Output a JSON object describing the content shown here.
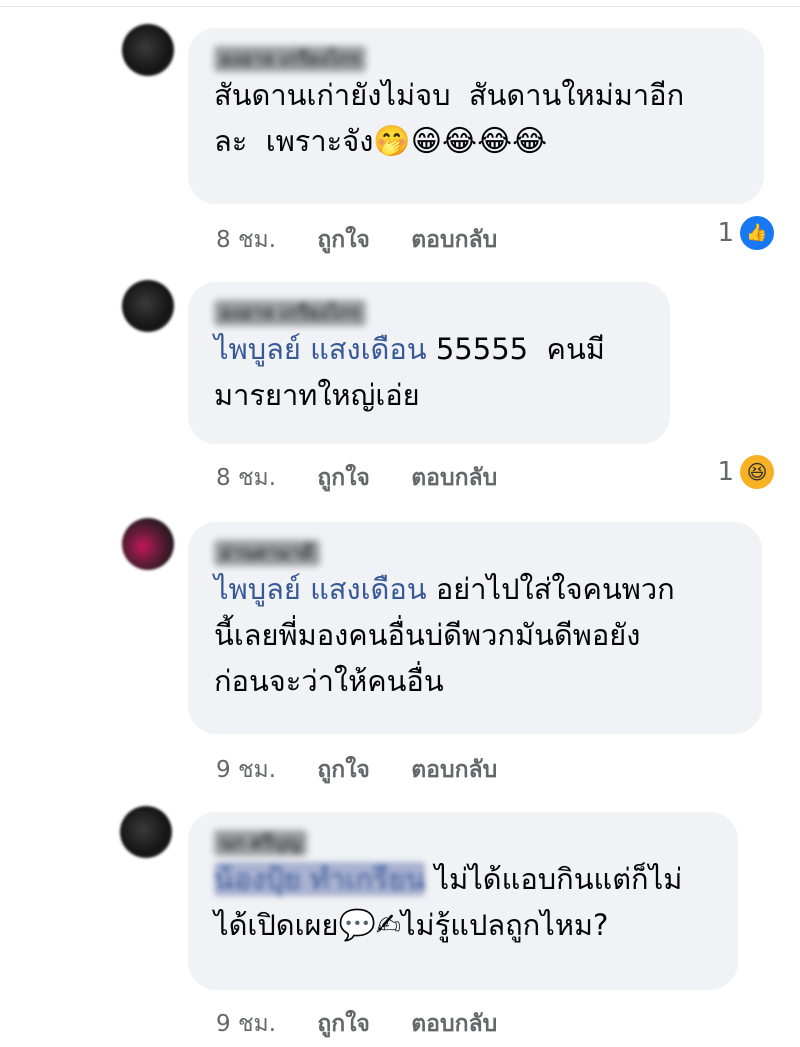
{
  "comments": [
    {
      "author": "องอาจ เกรียงไกร",
      "text": "สันดานเก่ายังไม่จบ  สันดานใหม่มาอีก\nละ  เพราะจัง",
      "emojis": "🤭😁😂😂😂",
      "time": "8 ชม.",
      "like_label": "ถูกใจ",
      "reply_label": "ตอบกลับ",
      "reaction_count": "1",
      "reaction_icon": "like-icon"
    },
    {
      "author": "องอาจ เกรียงไกร",
      "mention": "ไพบูลย์ แสงเดือน",
      "text": " 55555  คนมี\nมารยาทใหญ่เอ่ย",
      "time": "8 ชม.",
      "like_label": "ถูกใจ",
      "reply_label": "ตอบกลับ",
      "reaction_count": "1",
      "reaction_icon": "haha-icon"
    },
    {
      "author": "อ่านตามาดี",
      "mention": "ไพบูลย์ แสงเดือน",
      "text": " อย่าไปใส่ใจคนพวก\nนี้เลยพี่มองคนอื่นบ่ดีพวกมันดีพอยัง\nก่อนจะว่าให้คนอื่น",
      "time": "9 ชม.",
      "like_label": "ถูกใจ",
      "reply_label": "ตอบกลับ"
    },
    {
      "author": "นก ศรีบุญ",
      "mention": "น้องปุ้ย ทำเกรียน",
      "text": " ไม่ได้แอบกินแต่ก็ไม่\nได้เปิดเผย",
      "emojis_inline": "💬✍",
      "text_tail": "ไม่รู้แปลถูกไหม?",
      "time": "9 ชม.",
      "like_label": "ถูกใจ",
      "reply_label": "ตอบกลับ"
    }
  ]
}
